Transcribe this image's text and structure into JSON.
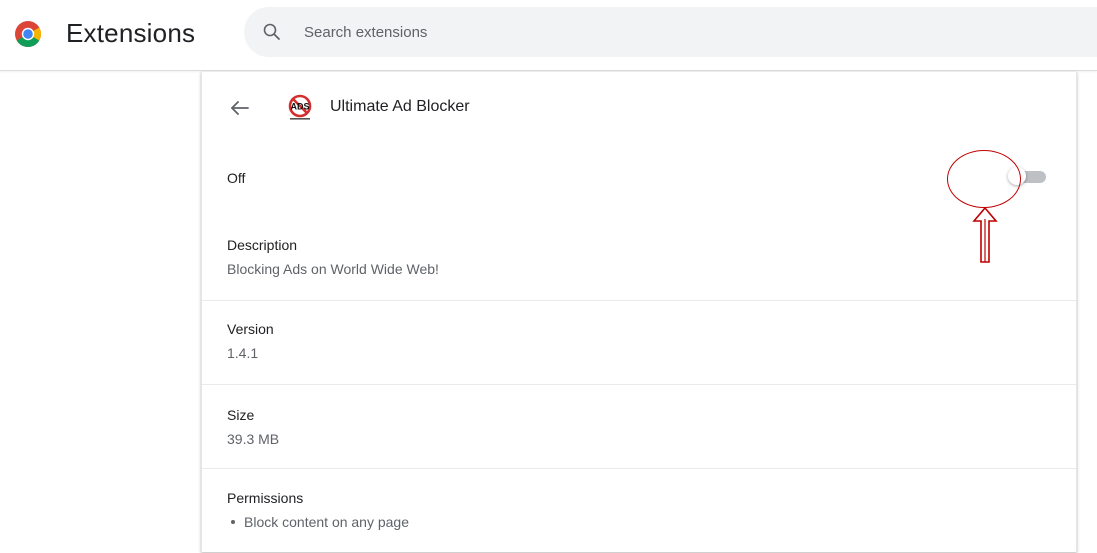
{
  "header": {
    "title": "Extensions",
    "search_placeholder": "Search extensions",
    "search_value": ""
  },
  "extension": {
    "name": "Ultimate Ad Blocker",
    "icon_text": "ADS",
    "state_label": "Off",
    "enabled": false
  },
  "details": {
    "description_label": "Description",
    "description_value": "Blocking Ads on World Wide Web!",
    "version_label": "Version",
    "version_value": "1.4.1",
    "size_label": "Size",
    "size_value": "39.3 MB",
    "permissions_label": "Permissions",
    "permissions": [
      "Block content on any page"
    ]
  },
  "icons": {
    "logo": "chrome-logo-icon",
    "search": "search-icon",
    "back": "arrow-back-icon",
    "extension": "ads-blocker-icon"
  },
  "colors": {
    "accent": "#1a73e8",
    "annotation": "#c00000",
    "toggle_off_track": "#bdc1c6"
  }
}
